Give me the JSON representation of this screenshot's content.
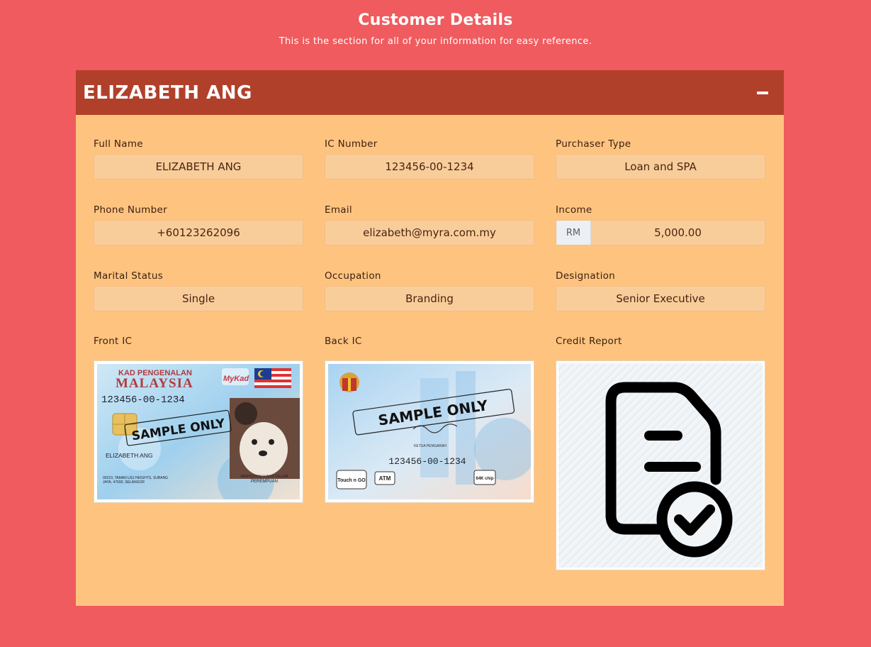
{
  "page": {
    "title": "Customer Details",
    "subtitle": "This is the section for all of your information for easy reference."
  },
  "customer": {
    "header_name": "ELIZABETH ANG",
    "collapse_icon": "minus-icon",
    "fields": {
      "full_name": {
        "label": "Full Name",
        "value": "ELIZABETH ANG"
      },
      "ic_number": {
        "label": "IC Number",
        "value": "123456-00-1234"
      },
      "purchaser_type": {
        "label": "Purchaser Type",
        "value": "Loan and SPA"
      },
      "phone": {
        "label": "Phone Number",
        "value": "+60123262096"
      },
      "email": {
        "label": "Email",
        "value": "elizabeth@myra.com.my"
      },
      "income": {
        "label": "Income",
        "currency": "RM",
        "value": "5,000.00"
      },
      "marital": {
        "label": "Marital Status",
        "value": "Single"
      },
      "occupation": {
        "label": "Occupation",
        "value": "Branding"
      },
      "designation": {
        "label": "Designation",
        "value": "Senior Executive"
      }
    },
    "documents": {
      "front_ic": {
        "label": "Front IC",
        "card_title_1": "KAD PENGENALAN",
        "card_title_2": "MALAYSIA",
        "card_brand": "MyKad",
        "card_number": "123456-00-1234",
        "watermark": "SAMPLE ONLY",
        "card_name": "ELIZABETH ANG",
        "card_address": "00210, TAMAN USJ HEIGHTS, SUBANG JAYA, 47600, SELANGOR",
        "card_citizen": "WARGANEGARA ISLAM PEREMPUAN"
      },
      "back_ic": {
        "label": "Back IC",
        "watermark": "SAMPLE ONLY",
        "card_number": "123456-00-1234",
        "card_signatory": "KETUA PENGARAH",
        "badge_touchngo": "Touch n GO",
        "badge_atm": "ATM",
        "badge_chip": "64K chip"
      },
      "credit_report": {
        "label": "Credit Report",
        "icon": "document-check-icon"
      }
    }
  },
  "colors": {
    "background": "#ef5b5e",
    "header": "#b1402b",
    "panel": "#fec47f",
    "field": "#f9cd9a"
  }
}
